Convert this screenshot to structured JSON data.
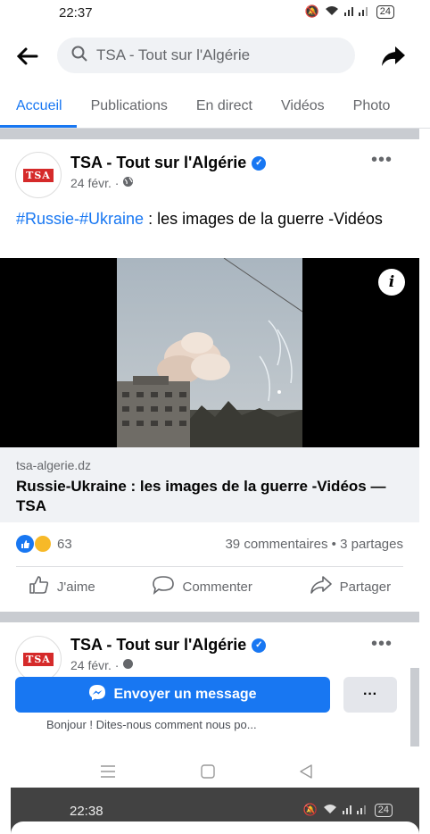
{
  "status_bar": {
    "time": "22:37",
    "battery": "24"
  },
  "header": {
    "search_text": "TSA - Tout sur l'Algérie"
  },
  "tabs": [
    {
      "label": "Accueil"
    },
    {
      "label": "Publications"
    },
    {
      "label": "En direct"
    },
    {
      "label": "Vidéos"
    },
    {
      "label": "Photo"
    }
  ],
  "post": {
    "logo_text": "TSA",
    "page_name": "TSA - Tout sur l'Algérie",
    "date": "24 févr. ·",
    "hashtag_1": "#Russie",
    "hashtag_sep": "-",
    "hashtag_2": "#Ukraine",
    "text": " : les images de la guerre -Vidéos",
    "link_domain": "tsa-algerie.dz",
    "link_title": "Russie-Ukraine : les images de la guerre -Vidéos — TSA",
    "reaction_count": "63",
    "comments_shares": "39 commentaires • 3 partages",
    "action_like": "J'aime",
    "action_comment": "Commenter",
    "action_share": "Partager"
  },
  "post2": {
    "logo_text": "TSA",
    "page_name": "TSA - Tout sur l'Algérie",
    "date": "24 févr. ·"
  },
  "message_bar": {
    "button_label": "Envoyer un message",
    "more_label": "···",
    "prompt": "Bonjour ! Dites-nous comment nous po..."
  },
  "bottom_status": {
    "time": "22:38",
    "battery": "24"
  },
  "colors": {
    "accent": "#1877f2",
    "separator": "#c9ccd1",
    "text_secondary": "#65676b"
  }
}
